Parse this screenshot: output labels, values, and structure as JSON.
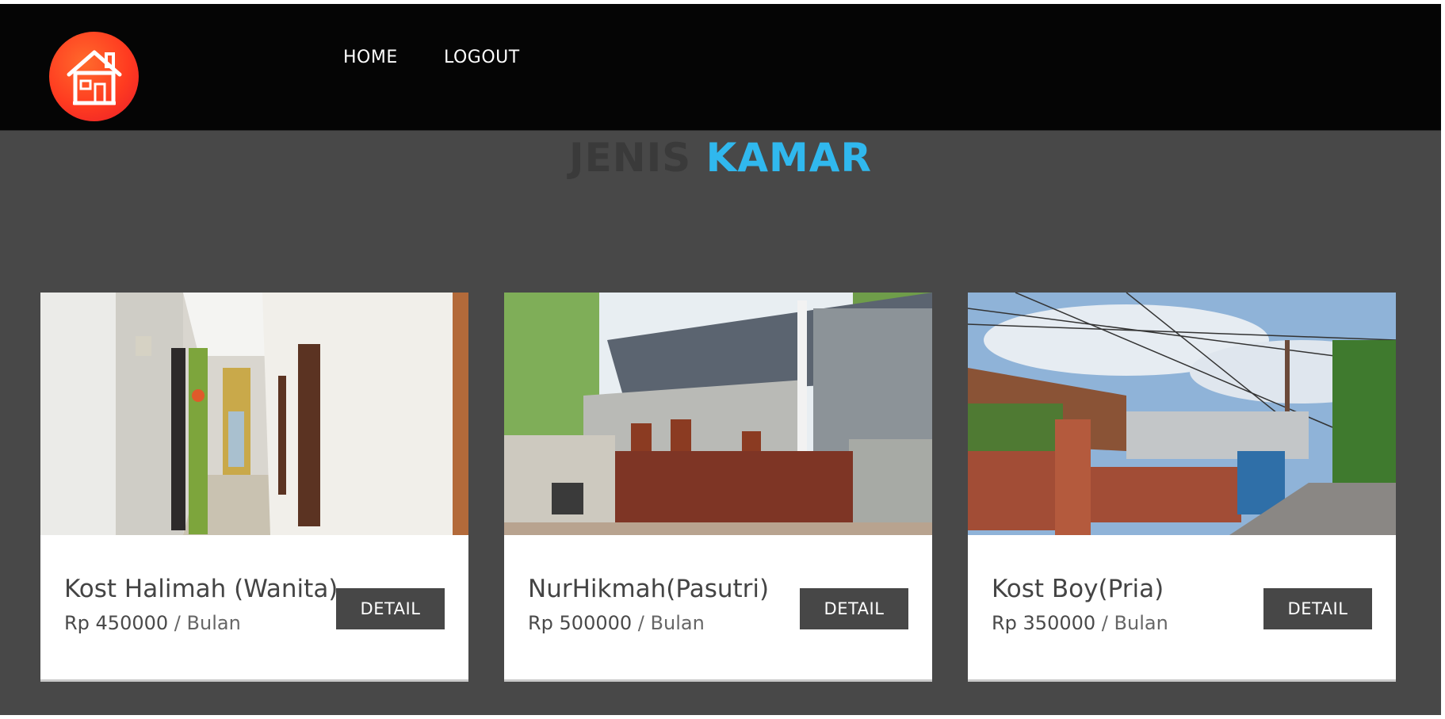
{
  "nav": {
    "logo_icon": "house-icon",
    "links": [
      "HOME",
      "LOGOUT"
    ]
  },
  "heading": {
    "part1": "JENIS",
    "part2": "KAMAR"
  },
  "colors": {
    "accent": "#30b8ee",
    "navbar": "#050505",
    "background": "#484848",
    "button": "#474747",
    "logo": "#ff3b20"
  },
  "cards": [
    {
      "title": "Kost Halimah (Wanita)",
      "price": "Rp 450000",
      "per": "/ Bulan",
      "button": "DETAIL"
    },
    {
      "title": "NurHikmah(Pasutri)",
      "price": "Rp 500000",
      "per": "/ Bulan",
      "button": "DETAIL"
    },
    {
      "title": "Kost Boy(Pria)",
      "price": "Rp 350000",
      "per": "/ Bulan",
      "button": "DETAIL"
    }
  ]
}
